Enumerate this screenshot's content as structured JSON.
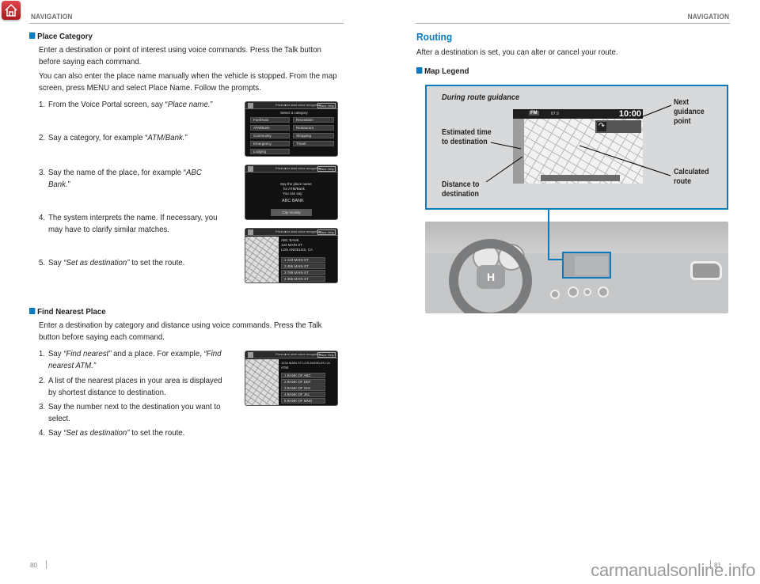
{
  "header": {
    "left_section": "NAVIGATION",
    "right_section": "NAVIGATION",
    "home_icon": "home-icon"
  },
  "left_page": {
    "place_category": {
      "heading": "Place Category",
      "paragraphs": [
        "Enter a destination or point of interest using voice commands. Press the Talk button before saying each command.",
        "You can also enter the place name manually when the vehicle is stopped. From the map screen, press MENU and select Place Name. Follow the prompts."
      ],
      "steps": [
        {
          "num": "1.",
          "pre": "From the Voice Portal screen, say “",
          "em": "Place name.",
          "post": "”"
        },
        {
          "num": "2.",
          "pre": "Say a category, for example “",
          "em": "ATM/Bank.",
          "post": "”"
        },
        {
          "num": "3.",
          "pre": "Say the name of the place, for example “",
          "em": "ABC Bank.",
          "post": "”"
        },
        {
          "num": "4.",
          "pre": "The system interprets the name. If necessary, you may have to clarify similar matches.",
          "em": "",
          "post": ""
        },
        {
          "num": "5.",
          "pre": "Say ",
          "em": "“Set as destination”",
          "post": " to set the route."
        }
      ],
      "screens": {
        "category": {
          "bar_text": "Press ■ to start voice recognition",
          "voice_help": "Voice Help",
          "title": "Select a category",
          "items": [
            "Fuel/Auto",
            "Recreation",
            "ATM/Bank",
            "Restaurant",
            "Community",
            "Shopping",
            "Emergency",
            "Travel",
            "Lodging"
          ]
        },
        "say_name": {
          "bar_text": "Press ■ to start voice recognition",
          "voice_help": "Voice Help",
          "lines": [
            "Say the place name",
            "for ATM/Bank",
            "You can say:"
          ],
          "example": "ABC BANK",
          "button": "City Vicinity"
        },
        "results": {
          "bar_text": "Press ■ to start voice recognition",
          "voice_help": "Voice Help",
          "address": [
            "ABC BANK",
            "123 MAIN ST",
            "LOS ANGELES, CA"
          ],
          "items": [
            "1 123 MAIN ST",
            "2 456 MAIN ST",
            "3 789 MAIN ST",
            "4 355 MAIN ST"
          ]
        }
      }
    },
    "find_nearest": {
      "heading": "Find Nearest Place",
      "paragraph": "Enter a destination by category and distance using voice commands. Press the Talk button before saying each command.",
      "steps": [
        {
          "num": "1.",
          "pre": "Say ",
          "em": "“Find nearest”",
          "post": " and a place. For example, ",
          "em2": "“Find nearest ATM.”"
        },
        {
          "num": "2.",
          "pre": "A list of the nearest places in your area is displayed by shortest distance to destination.",
          "em": "",
          "post": ""
        },
        {
          "num": "3.",
          "pre": "Say the number next to the destination you want to select.",
          "em": "",
          "post": ""
        },
        {
          "num": "4.",
          "pre": "Say ",
          "em": "“Set as destination”",
          "post": " to set the route."
        }
      ],
      "screen": {
        "bar_text": "Press ■ to start voice recognition",
        "voice_help": "Voice Help",
        "address": "1234 MAIN ST LOS ANGELES CA",
        "category": "ATM",
        "items": [
          "1  BANK OF ABC",
          "2  BANK OF DEF",
          "3  BANK OF GHI",
          "4  BANK OF JKL",
          "5  BANK OF MNO"
        ]
      }
    },
    "page_number": "80"
  },
  "right_page": {
    "title": "Routing",
    "intro": "After a destination is set, you can alter or cancel your route.",
    "map_legend": {
      "heading": "Map Legend",
      "caption": "During route guidance",
      "callouts": {
        "next_guidance": "Next guidance point",
        "estimated_time": "Estimated time to destination",
        "distance": "Distance to destination",
        "calculated_route": "Calculated route"
      },
      "nav_screen": {
        "source": "FM",
        "station": "87.9",
        "time": "10:00"
      }
    },
    "page_number": "81"
  },
  "footer": {
    "watermark": "carmanualsonline.info"
  },
  "colors": {
    "accent_blue": "#0a7bbf",
    "header_gray": "#6d6e71",
    "home_red": "#c8262c"
  }
}
